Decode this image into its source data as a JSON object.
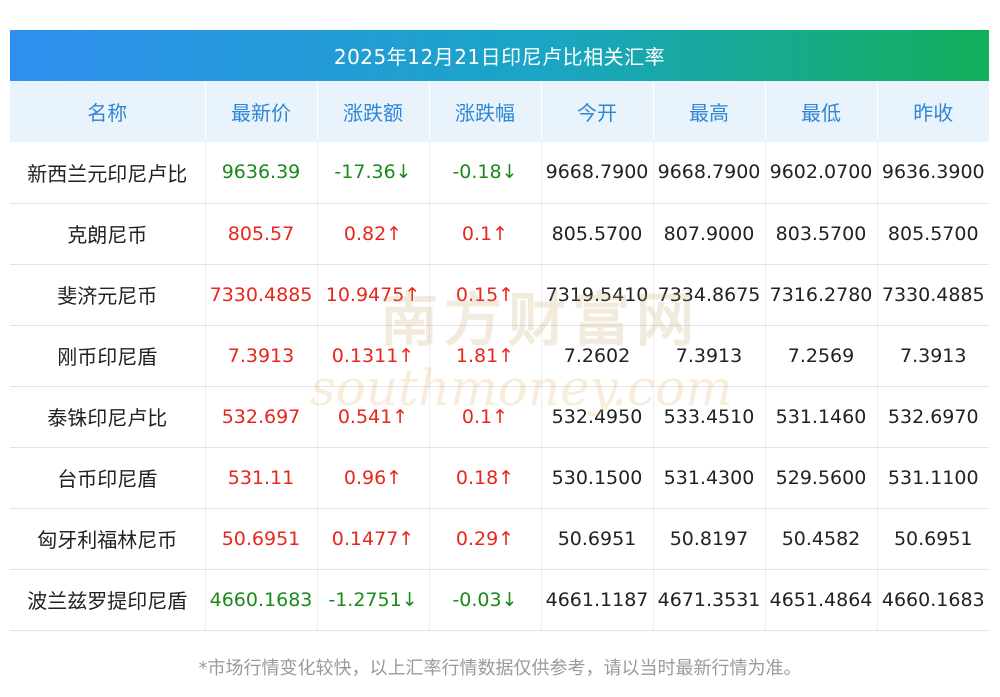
{
  "title": "2025年12月21日印尼卢比相关汇率",
  "headers": [
    "名称",
    "最新价",
    "涨跌额",
    "涨跌幅",
    "今开",
    "最高",
    "最低",
    "昨收"
  ],
  "rows": [
    {
      "name": "新西兰元印尼卢比",
      "price": "9636.39",
      "change": "-17.36↓",
      "pct": "-0.18↓",
      "open": "9668.7900",
      "high": "9668.7900",
      "low": "9602.0700",
      "prev": "9636.3900",
      "dir": "down"
    },
    {
      "name": "克朗尼币",
      "price": "805.57",
      "change": "0.82↑",
      "pct": "0.1↑",
      "open": "805.5700",
      "high": "807.9000",
      "low": "803.5700",
      "prev": "805.5700",
      "dir": "up"
    },
    {
      "name": "斐济元尼币",
      "price": "7330.4885",
      "change": "10.9475↑",
      "pct": "0.15↑",
      "open": "7319.5410",
      "high": "7334.8675",
      "low": "7316.2780",
      "prev": "7330.4885",
      "dir": "up"
    },
    {
      "name": "刚币印尼盾",
      "price": "7.3913",
      "change": "0.1311↑",
      "pct": "1.81↑",
      "open": "7.2602",
      "high": "7.3913",
      "low": "7.2569",
      "prev": "7.3913",
      "dir": "up"
    },
    {
      "name": "泰铢印尼卢比",
      "price": "532.697",
      "change": "0.541↑",
      "pct": "0.1↑",
      "open": "532.4950",
      "high": "533.4510",
      "low": "531.1460",
      "prev": "532.6970",
      "dir": "up"
    },
    {
      "name": "台币印尼盾",
      "price": "531.11",
      "change": "0.96↑",
      "pct": "0.18↑",
      "open": "530.1500",
      "high": "531.4300",
      "low": "529.5600",
      "prev": "531.1100",
      "dir": "up"
    },
    {
      "name": "匈牙利福林尼币",
      "price": "50.6951",
      "change": "0.1477↑",
      "pct": "0.29↑",
      "open": "50.6951",
      "high": "50.8197",
      "low": "50.4582",
      "prev": "50.6951",
      "dir": "up"
    },
    {
      "name": "波兰兹罗提印尼盾",
      "price": "4660.1683",
      "change": "-1.2751↓",
      "pct": "-0.03↓",
      "open": "4661.1187",
      "high": "4671.3531",
      "low": "4651.4864",
      "prev": "4660.1683",
      "dir": "down"
    }
  ],
  "note": "*市场行情变化较快，以上汇率行情数据仅供参考，请以当时最新行情为准。",
  "watermark": {
    "cn": "南方财富网",
    "en": "southmoney.com"
  },
  "colors": {
    "up": "#e8261d",
    "down": "#1a8a1a",
    "header_text": "#2f86d6",
    "header_bg": "#e9f3fb"
  }
}
